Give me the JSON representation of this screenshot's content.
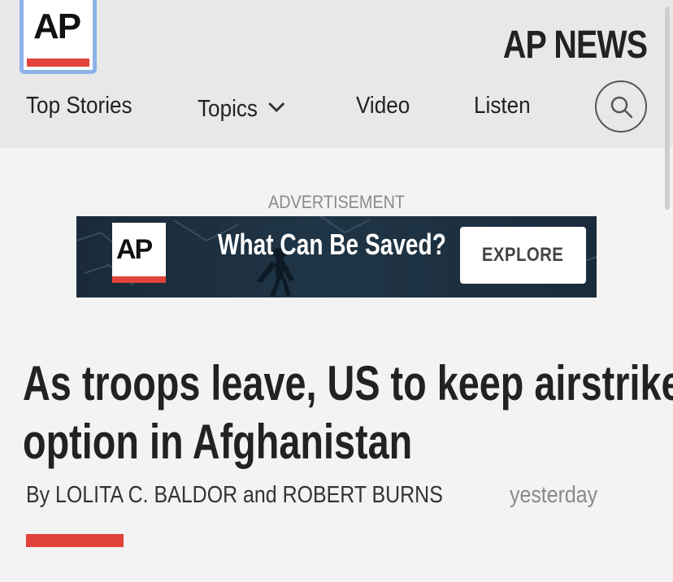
{
  "header": {
    "logo_text": "AP",
    "brand": "AP NEWS",
    "nav": [
      {
        "label": "Top Stories"
      },
      {
        "label": "Topics"
      },
      {
        "label": "Video"
      },
      {
        "label": "Listen"
      }
    ],
    "search_icon": "search-icon",
    "chevron_icon": "chevron-down-icon"
  },
  "ad": {
    "label": "ADVERTISEMENT",
    "logo_text": "AP",
    "headline": "What Can Be Saved?",
    "button_label": "EXPLORE"
  },
  "article": {
    "headline_line1": "As troops leave, US to keep airstrike",
    "headline_line2": "option in Afghanistan",
    "byline": "By LOLITA C. BALDOR and ROBERT BURNS",
    "timestamp": "yesterday"
  },
  "colors": {
    "accent": "#e2433a",
    "header_bg": "#e8e8e8",
    "page_bg": "#f3f3f3",
    "logo_border": "#8db2e8"
  }
}
